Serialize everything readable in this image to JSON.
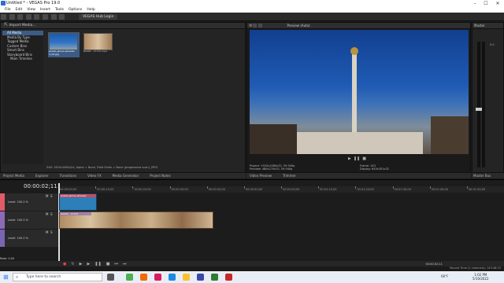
{
  "window": {
    "title": "Untitled * - VEGAS Pro 19.0"
  },
  "menu": [
    "File",
    "Edit",
    "View",
    "Insert",
    "Tools",
    "Options",
    "Help"
  ],
  "toolbar": {
    "hub_label": "VEGAS Hub Login"
  },
  "explorer": {
    "title": "Import Media...",
    "tree": [
      "All Media",
      "Media By Type",
      "Tagged Media",
      "Custom Bins",
      "Smart Bins",
      "Storyboard Bins",
      "Main Timeline"
    ],
    "media": [
      {
        "name": "pexels-james-wheeler-4_00.jpg"
      },
      {
        "name": "Rabbit - 21722.mp4"
      }
    ],
    "status": "048: 1920x1080x24, Alpha = None, Field Order = None (progressive scan), JPEG"
  },
  "preview": {
    "label": "Preview (Auto)",
    "project_info": "Project: 1920x1080x32, 59.940p",
    "preview_info": "Preview: 480x270x32, 59.940p",
    "display_info": "Display: 643x351x32",
    "frame_label": "Frame: 143",
    "display_label": "Display: 643x351x32"
  },
  "master": {
    "title": "Master",
    "db_value": "0.0",
    "bus_label": "Master Bus"
  },
  "tabs_left": [
    "Project Media",
    "Explorer",
    "Transitions",
    "Video FX",
    "Media Generator",
    "Project Notes"
  ],
  "tabs_right": [
    "Video Preview",
    "Trimmer"
  ],
  "timeline": {
    "timecode": "00:00:02;11",
    "tracks": [
      {
        "level": "Level: 100.0 %",
        "color": "#e35a6a"
      },
      {
        "level": "Level: 100.0 %",
        "color": "#8c6bb6"
      },
      {
        "level": "Level: 100.0 %",
        "color": "#7a66b0"
      }
    ],
    "ruler": [
      "00:00:00;00",
      "00:00:10;00",
      "00:00:20;00",
      "00:00:30;00",
      "00:00:40;00",
      "00:00:50;00",
      "00:01:00;00",
      "00:01:10;00",
      "00:01:20;00",
      "00:01:30;00",
      "00:01:40;00",
      "00:01:50;00"
    ],
    "clip1_name": "pexels-james-wheeler",
    "clip2_name": "Rabbit - 21722",
    "rate": "Rate: 0.00",
    "transport_timecode": "00:00:02;11",
    "record_time": "Record Time (2 channels): 143:48:15"
  },
  "taskbar": {
    "search_placeholder": "Type here to search",
    "weather": "68°F",
    "time": "1:02 PM",
    "date": "5/10/2022"
  },
  "colors": {
    "accent": "#3c5c86",
    "clip_video": "#2c7fb8",
    "clip_rabbit": "#d18a52",
    "taskbar": "#e9eef6"
  }
}
